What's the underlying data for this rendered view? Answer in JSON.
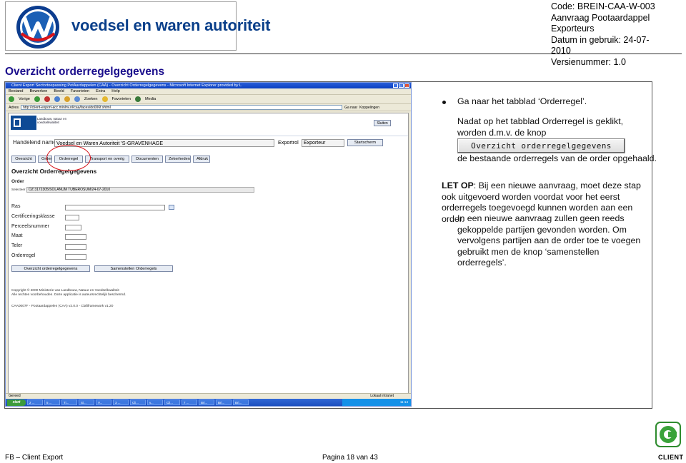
{
  "header": {
    "logo_text": "voedsel en waren autoriteit",
    "code": "Code: BREIN-CAA-W-003",
    "subject": "Aanvraag Pootaardappel Exporteurs",
    "date": "Datum in gebruik: 24-07-2010",
    "version": "Versienummer: 1.0"
  },
  "section_title": "Overzicht orderregelgegevens",
  "ie": {
    "title": "Client Export Sectortoepassing PotAardappelen (CAA) - Overzicht Orderregelgegevens - Microsoft Internet Explorer provided by L",
    "menu": [
      "Bestand",
      "Bewerken",
      "Beeld",
      "Favorieten",
      "Extra",
      "Help"
    ],
    "toolbar": [
      "Vorige",
      "Zoeken",
      "Favorieten",
      "Media"
    ],
    "address_label": "Adres",
    "address": "http://client-export-acc.minlnv.nl/caa/faces/do006f.xhtml",
    "go_label": "Ga naar",
    "links_label": "Koppelingen",
    "ministry_name": "Landbouw, natuur en voedselkwaliteit",
    "close_label": "Sluiten",
    "handelend_label": "Handelend namens",
    "handelend_value": "Voedsel en Waren Autoriteit 'S-GRAVENHAGE",
    "exportrol_label": "Exportrol",
    "exportrol_value": "Exporteur",
    "startscherm_label": "Startscherm",
    "tabs": [
      "Overzicht",
      "Order",
      "Orderregel",
      "Transport en overig",
      "Documenten",
      "Zekerheden",
      "Afdruk"
    ],
    "page_title": "Overzicht Orderregelgegevens",
    "order_label": "Order",
    "order_radio": "Selecteer",
    "order_value": "OZ:3172305/SOLANUM TUBEROSUM/24-07-2010",
    "fields": [
      "Ras",
      "Certificeringsklasse",
      "Perceelsnummer",
      "Maat",
      "Teler",
      "Orderregel"
    ],
    "btn_overview": "Overzicht orderregelgegevens",
    "btn_compose": "Samenstellen Orderregels",
    "copyright_1": "Copyright © 2000 Ministerie van Landbouw, Natuur en Voedselkwaliteit",
    "copyright_2": "Alle rechten voorbehouden. Deze applicatie is auteursrechtelijk beschermd.",
    "version_line": "CAA0007F - Pootaardappelen (CAA) v2.0.0 - Clafiframework v1.20",
    "status_left": "Gereed",
    "status_zone": "Lokaal intranet",
    "start_label": "start",
    "tasks": [
      "2 ...",
      "5 ...",
      "Ti...",
      "Si...",
      "V...",
      "3 ...",
      "Cli...",
      "v...",
      "Cli...",
      "7 ...",
      "Bri...",
      "Bri...",
      "Bri..."
    ],
    "clock": "11:14"
  },
  "notes": {
    "bullet": "Ga naar het tabblad ‘Orderregel’.",
    "open": "Nadat op het tabblad  Orderregel  is geklikt, worden d.m.v. de knop",
    "button_label": "Overzicht orderregelgegevens",
    "fetched": "de bestaande orderregels van de order opgehaald.",
    "warn_label": "LET OP",
    "warn_text": ": Bij een nieuwe aanvraag, moet deze stap ook uitgevoerd worden voordat voor het eerst orderregels toegevoegd kunnen worden aan een order.",
    "warn_indent": "In een nieuwe aanvraag zullen geen reeds gekoppelde partijen gevonden worden. Om vervolgens partijen aan de order toe te voegen gebruikt men de knop ‘samenstellen orderregels’."
  },
  "footer": {
    "left": "FB – Client Export",
    "page": "Pagina 18 van 43",
    "client_word": "CLIENT"
  }
}
